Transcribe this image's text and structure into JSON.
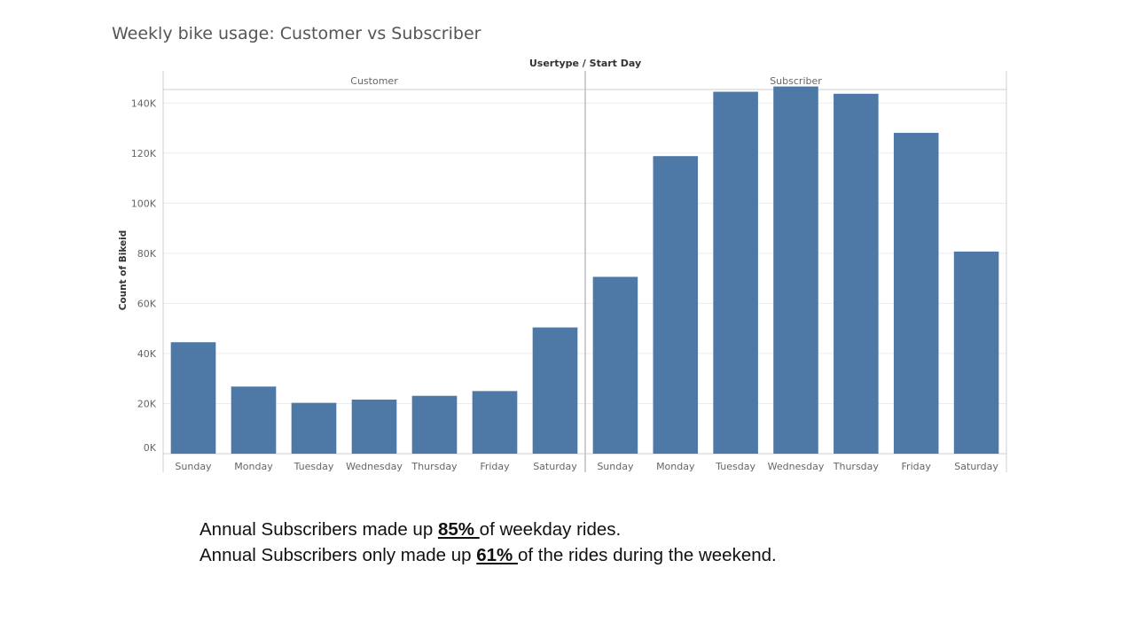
{
  "chart_data": {
    "type": "bar",
    "title": "Weekly bike usage: Customer vs Subscriber",
    "column_header": "Usertype / Start Day",
    "ylabel": "Count of Bikeid",
    "ylim": [
      0,
      150000
    ],
    "y_ticks": [
      {
        "value": 0,
        "label": "0K"
      },
      {
        "value": 20000,
        "label": "20K"
      },
      {
        "value": 40000,
        "label": "40K"
      },
      {
        "value": 60000,
        "label": "60K"
      },
      {
        "value": 80000,
        "label": "80K"
      },
      {
        "value": 100000,
        "label": "100K"
      },
      {
        "value": 120000,
        "label": "120K"
      },
      {
        "value": 140000,
        "label": "140K"
      }
    ],
    "grid": true,
    "bar_color": "#4e79a7",
    "categories": [
      "Sunday",
      "Monday",
      "Tuesday",
      "Wednesday",
      "Thursday",
      "Friday",
      "Saturday"
    ],
    "panels": [
      {
        "name": "Customer",
        "values": [
          44500,
          26800,
          20300,
          21600,
          23100,
          25000,
          50400
        ]
      },
      {
        "name": "Subscriber",
        "values": [
          70600,
          118800,
          144500,
          146600,
          143700,
          128100,
          80700
        ]
      }
    ]
  },
  "notes": {
    "line1": {
      "before": "Annual Subscribers made up ",
      "pct": "85% ",
      "after": "of weekday rides."
    },
    "line2": {
      "before": "Annual Subscribers only made up ",
      "pct": "61% ",
      "after": "of the rides during the weekend."
    }
  }
}
